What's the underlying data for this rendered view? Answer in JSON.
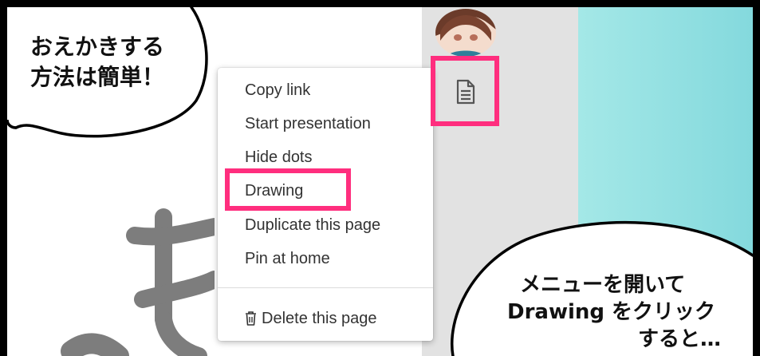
{
  "bubble_top_left": {
    "lines": [
      "おえかきする",
      "方法は簡単！"
    ]
  },
  "bubble_bottom_right": {
    "lines": [
      "メニューを開いて",
      "Drawing をクリック",
      "すると…"
    ]
  },
  "menu": {
    "items": [
      "Copy link",
      "Start presentation",
      "Hide dots",
      "Drawing",
      "Duplicate this page",
      "Pin at home"
    ],
    "delete_label": "Delete this page"
  },
  "icons": {
    "page": "page-icon",
    "trash": "trash-icon",
    "avatar": "avatar"
  },
  "colors": {
    "highlight": "#ff2e7e",
    "teal": "#84d9dd",
    "gray_panel": "#e2e2e2"
  }
}
